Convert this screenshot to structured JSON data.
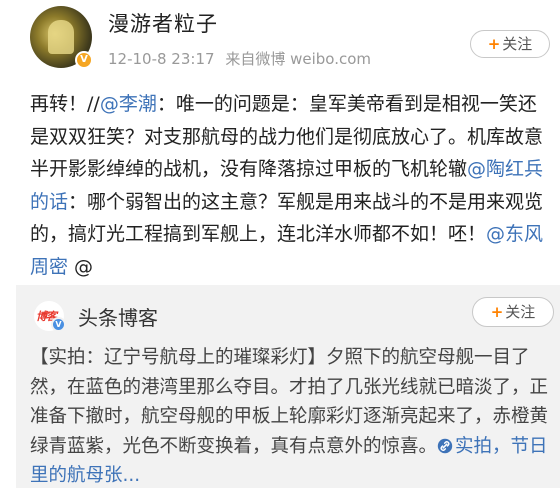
{
  "author": {
    "name": "漫游者粒子",
    "timestamp": "12-10-8 23:17",
    "source": "来自微博 weibo.com",
    "follow_label": "关注",
    "verified_badge": "V"
  },
  "post": {
    "t1": "再转！//",
    "m1": "@李潮",
    "t2": "：唯一的问题是：皇军美帝看到是相视一笑还是双双狂笑？对支那航母的战力他们是彻底放心了。机库故意半开影影绰绰的战机，没有降落掠过甲板的飞机轮辙",
    "m2": "@陶红兵的话",
    "t3": "：哪个弱智出的这主意？军舰是用来战斗的不是用来观览的，搞灯光工程搞到军舰上，连北洋水师都不如！呸！",
    "m3": "@东风周密",
    "t4": " @"
  },
  "retweet": {
    "name": "头条博客",
    "logo_text": "博客",
    "follow_label": "关注",
    "badge": "V",
    "text": "【实拍：辽宁号航母上的璀璨彩灯】夕照下的航空母舰一目了然，在蓝色的港湾里那么夺目。才拍了几张光线就已暗淡了，正准备下撤时，航空母舰的甲板上轮廓彩灯逐渐亮起来了，赤橙黄绿青蓝紫，光色不断变换着，真有点意外的惊喜。",
    "link_text": "实拍，节日里的航母张...",
    "link_icon": "link-icon"
  },
  "colors": {
    "link": "#3e73b8",
    "accent": "#ff8200",
    "verified": "#f5a623",
    "retweet_bg": "#f2f2f2"
  }
}
